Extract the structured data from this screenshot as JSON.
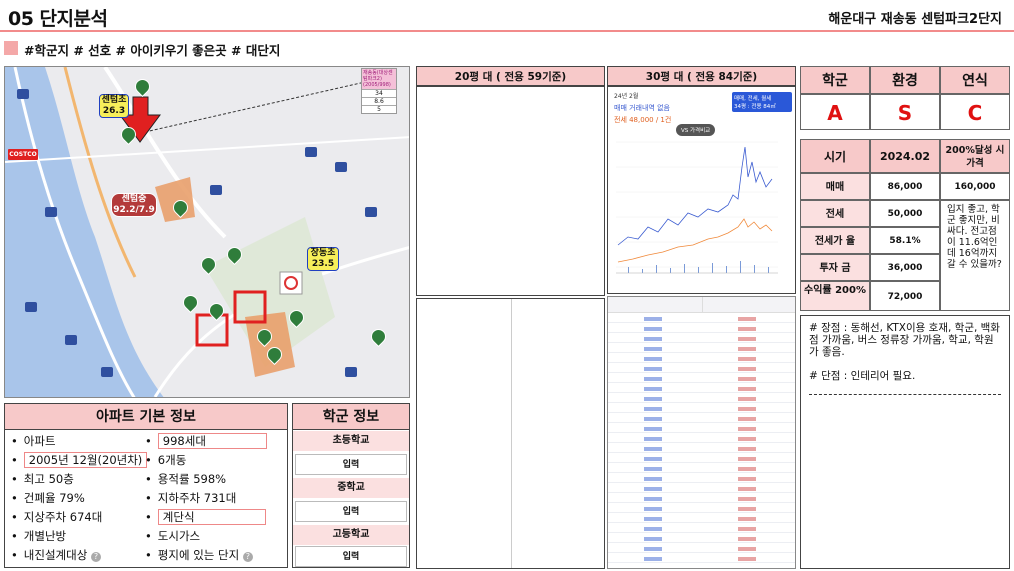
{
  "header": {
    "title": "05 단지분석",
    "subtitle": "해운대구 재송동 센텀파크2단지",
    "tags": "#학군지 # 선호 # 아이키우기 좋은곳 # 대단지"
  },
  "map": {
    "legend_header": "재송동(대상센텀파크2)(2005/998)",
    "legend_rows": [
      "34",
      "8.6",
      "5"
    ],
    "school_labels": [
      {
        "name": "센텀초",
        "score": "26.3"
      },
      {
        "name": "센텀중",
        "score": "92.2/7.9"
      },
      {
        "name": "장동초",
        "score": "23.5"
      }
    ],
    "store_label": "COSTCO",
    "colors": {
      "accent": "#f28b8b",
      "pink_header": "#f7c9c9",
      "grade_red": "#e01010"
    }
  },
  "apartment_info": {
    "title": "아파트 기본 정보",
    "left": [
      "아파트",
      "2005년 12월(20년차)",
      "최고 50층",
      "건폐율 79%",
      "지상주차 674대",
      "개별난방",
      "내진설계대상"
    ],
    "right": [
      "998세대",
      "6개동",
      "용적률 598%",
      "지하주차 731대",
      "계단식",
      "도시가스",
      "평지에 있는 단지"
    ]
  },
  "school_info": {
    "title": "학군 정보",
    "rows": [
      {
        "label": "초등학교",
        "value": "입력"
      },
      {
        "label": "중학교",
        "value": "입력"
      },
      {
        "label": "고등학교",
        "value": "입력"
      }
    ]
  },
  "panels": {
    "p20": "20평 대 ( 전용 59기준)",
    "p30": "30평 대 ( 전용 84기준)",
    "chart": {
      "date": "24년 2월",
      "no_trade": "매매 거래내역 없음",
      "jeonse": "전세 48,000 / 1건",
      "badge1": "매매, 전세, 월세",
      "badge2": "34평 : 전용 84㎡",
      "compare": "VS 가격비교"
    }
  },
  "grades": {
    "headers": [
      "학군",
      "환경",
      "연식"
    ],
    "values": [
      "A",
      "S",
      "C"
    ]
  },
  "price_table": {
    "header": [
      "시기",
      "2024.02",
      "200%달성 시 가격"
    ],
    "rows": [
      {
        "label": "매매",
        "value": "86,000",
        "target": "160,000"
      },
      {
        "label": "전세",
        "value": "50,000"
      },
      {
        "label": "전세가 율",
        "value": "58.1%"
      },
      {
        "label": "투자 금",
        "value": "36,000"
      },
      {
        "label": "수익률 200%",
        "value": "72,000"
      }
    ],
    "comment": "입지 좋고, 학군 좋지만, 비싸다. 전고점이 11.6억인데 16억까지 갈 수 있을까?"
  },
  "notes": {
    "pros": "# 장점 : 동해선, KTX이용 호재, 학군, 백화점 가까움, 버스 정류장 가까움, 학교, 학원가 좋음.",
    "cons": "# 단점 : 인테리어 필요."
  }
}
